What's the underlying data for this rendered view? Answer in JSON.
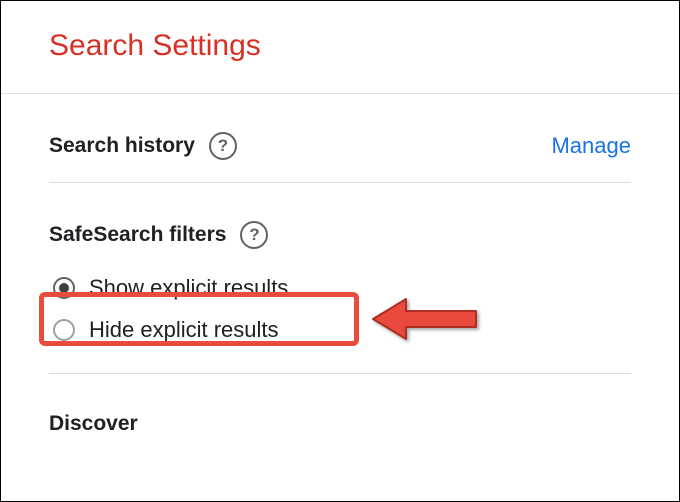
{
  "header": {
    "title": "Search Settings"
  },
  "sections": {
    "searchHistory": {
      "label": "Search history",
      "manage": "Manage"
    },
    "safeSearch": {
      "label": "SafeSearch filters",
      "options": {
        "show": "Show explicit results",
        "hide": "Hide explicit results"
      }
    },
    "discover": {
      "label": "Discover"
    }
  },
  "icons": {
    "help": "?"
  }
}
